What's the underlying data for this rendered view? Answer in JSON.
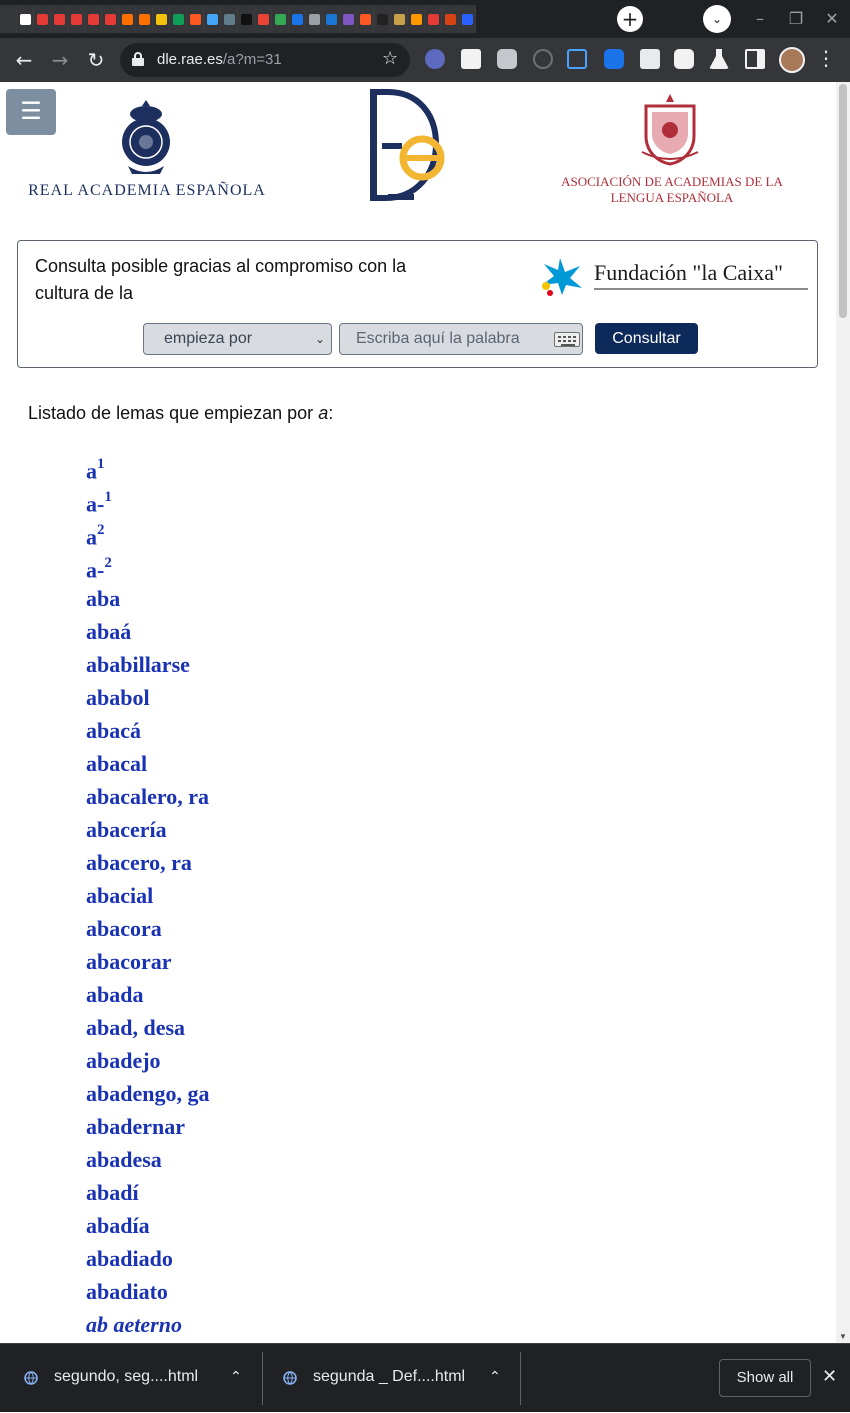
{
  "browser": {
    "url_host": "dle.rae.es",
    "url_path": "/a?m=31",
    "new_tab_symbol": "+",
    "tab_favicon_colors": [
      "#35363a",
      "#ffffff",
      "#e53935",
      "#e53935",
      "#e53935",
      "#e53935",
      "#e53935",
      "#ff6f00",
      "#ff6f00",
      "#f4c20d",
      "#0f9d58",
      "#ff5722",
      "#42a5f5",
      "#607d8b",
      "#111111",
      "#ea4335",
      "#34a853",
      "#1a73e8",
      "#9aa0a6",
      "#1976d2",
      "#7e57c2",
      "#ff5722",
      "#222222",
      "#c8a04a",
      "#ff9800",
      "#e53935",
      "#d84315",
      "#2962ff"
    ],
    "extension_icons": [
      "globe-extension-icon",
      "skull-extension-icon",
      "puzzle-extension-icon",
      "block-extension-icon",
      "capture-extension-icon",
      "puzzle-blue-extension-icon",
      "document-extension-icon",
      "puzzle-white-extension-icon",
      "flask-extension-icon",
      "sidebar-icon"
    ]
  },
  "header": {
    "menu_symbol": "☰",
    "rae_text": "REAL ACADEMIA ESPAÑOLA",
    "asale_line1": "ASOCIACIÓN DE ACADEMIAS DE LA",
    "asale_line2": "LENGUA ESPAÑOLA"
  },
  "sponsor": {
    "text": "Consulta posible gracias al compromiso con la cultura de la",
    "brand": "Fundación \"la Caixa\"",
    "select_value": "empieza por",
    "input_placeholder": "Escriba aquí la palabra",
    "button_label": "Consultar"
  },
  "intro": {
    "prefix": "Listado de lemas que empiezan por ",
    "letter": "a",
    "suffix": ":"
  },
  "lemmas": [
    {
      "text": "a",
      "sup": "1"
    },
    {
      "text": "a-",
      "sup": "1"
    },
    {
      "text": "a",
      "sup": "2"
    },
    {
      "text": "a-",
      "sup": "2"
    },
    {
      "text": "aba"
    },
    {
      "text": "abaá"
    },
    {
      "text": "ababillarse"
    },
    {
      "text": "ababol"
    },
    {
      "text": "abacá"
    },
    {
      "text": "abacal"
    },
    {
      "text": "abacalero, ra"
    },
    {
      "text": "abacería"
    },
    {
      "text": "abacero, ra"
    },
    {
      "text": "abacial"
    },
    {
      "text": "abacora"
    },
    {
      "text": "abacorar"
    },
    {
      "text": "abada"
    },
    {
      "text": "abad, desa"
    },
    {
      "text": "abadejo"
    },
    {
      "text": "abadengo, ga"
    },
    {
      "text": "abadernar"
    },
    {
      "text": "abadesa"
    },
    {
      "text": "abadí"
    },
    {
      "text": "abadía"
    },
    {
      "text": "abadiado"
    },
    {
      "text": "abadiato"
    },
    {
      "text": "ab aeterno",
      "italic": true
    }
  ],
  "downloads": {
    "items": [
      "segundo, seg....html",
      "segunda _ Def....html"
    ],
    "show_all": "Show all"
  }
}
